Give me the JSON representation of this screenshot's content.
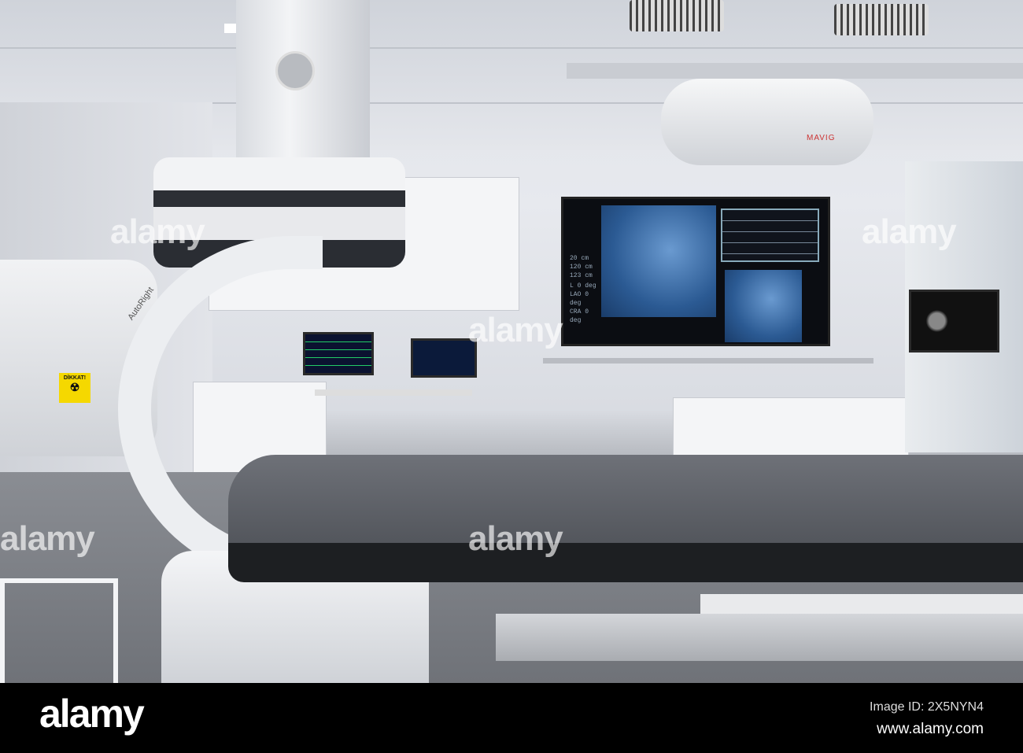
{
  "photo": {
    "warning_sign": "DİKKAT!",
    "c_arm_label": "AutoRight",
    "ceiling_arm_brand": "MAVIG",
    "monitor": {
      "labels": [
        "L",
        "LAO",
        "CRA"
      ],
      "values": [
        "0 deg",
        "0 deg",
        "0 deg"
      ],
      "readouts": [
        "20 cm",
        "120 cm",
        "123 cm"
      ]
    }
  },
  "watermark": {
    "text": "alamy"
  },
  "footer": {
    "logo": "alamy",
    "image_id": "Image ID: 2X5NYN4",
    "url": "www.alamy.com"
  }
}
